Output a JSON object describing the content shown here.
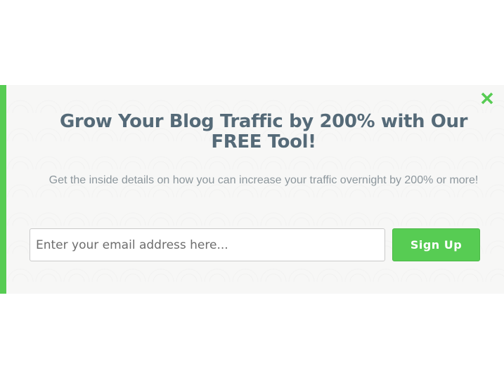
{
  "popup": {
    "headline": "Grow Your Blog Traffic by 200% with Our FREE Tool!",
    "subtext": "Get the inside details on how you can increase your traffic overnight by 200% or more!",
    "close_icon": "close-x-icon",
    "email": {
      "placeholder": "Enter your email address here...",
      "value": ""
    },
    "signup_label": "Sign Up"
  },
  "colors": {
    "accent": "#57cc53",
    "headline": "#556a78",
    "subtext": "#8c969c"
  }
}
